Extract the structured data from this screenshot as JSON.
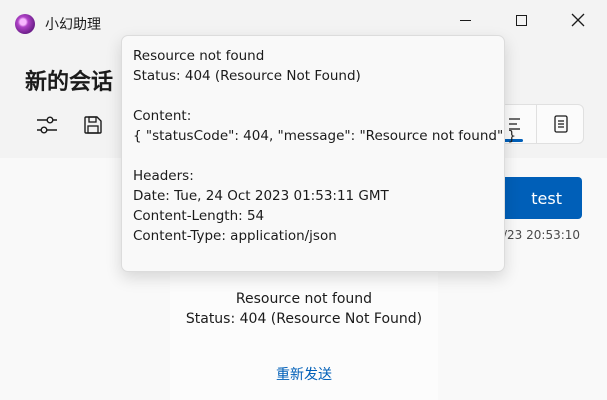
{
  "window": {
    "app_title": "小幻助理",
    "icons": {
      "minimize": "minimize-icon",
      "maximize": "maximize-icon",
      "close": "close-icon"
    }
  },
  "header": {
    "conversation_title": "新的会话",
    "toolbar_icons": [
      "settings-sliders-icon",
      "save-icon"
    ],
    "view_toggle_icons": [
      "text-lines-icon",
      "document-icon"
    ]
  },
  "tooltip": {
    "title": "Resource not found",
    "status": "Status: 404 (Resource Not Found)",
    "content_label": "Content:",
    "content_value": "{ \"statusCode\": 404, \"message\": \"Resource not found\" }",
    "headers_label": "Headers:",
    "headers": [
      "Date: Tue, 24 Oct 2023 01:53:11 GMT",
      "Content-Length: 54",
      "Content-Type: application/json"
    ]
  },
  "chat": {
    "user_message": "test",
    "user_message_time": "/23 20:53:10",
    "error_title": "Resource not found",
    "error_status": "Status: 404 (Resource Not Found)",
    "resend_label": "重新发送"
  },
  "colors": {
    "accent": "#005fb8",
    "background": "#f3f3f3"
  }
}
